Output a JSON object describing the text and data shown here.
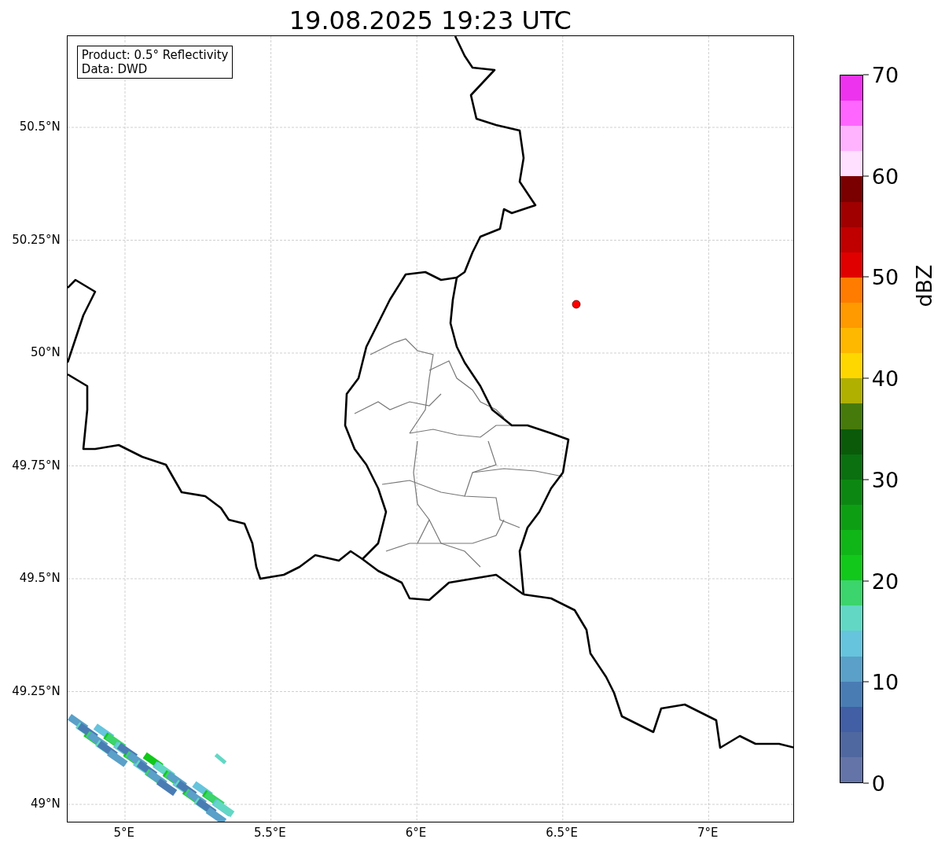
{
  "title": "19.08.2025 19:23 UTC",
  "info_box": {
    "lines": [
      "Product: 0.5° Reflectivity",
      "Data: DWD"
    ]
  },
  "map": {
    "yticks": [
      "50.5°N",
      "50.25°N",
      "50°N",
      "49.75°N",
      "49.5°N",
      "49.25°N",
      "49°N"
    ],
    "xticks": [
      "5°E",
      "5.5°E",
      "6°E",
      "6.5°E",
      "7°E"
    ]
  },
  "colorbar": {
    "label": "dBZ",
    "ticks": [
      "70",
      "60",
      "50",
      "40",
      "30",
      "20",
      "10",
      "0"
    ],
    "segments": [
      {
        "color": "#ee33ee"
      },
      {
        "color": "#ff66ff"
      },
      {
        "color": "#ffb3ff"
      },
      {
        "color": "#ffe0ff"
      },
      {
        "color": "#7a0000"
      },
      {
        "color": "#a00000"
      },
      {
        "color": "#c00000"
      },
      {
        "color": "#e00000"
      },
      {
        "color": "#ff7c00"
      },
      {
        "color": "#ff9a00"
      },
      {
        "color": "#ffb800"
      },
      {
        "color": "#ffd700"
      },
      {
        "color": "#b0b000"
      },
      {
        "color": "#467a0a"
      },
      {
        "color": "#0a5a0a"
      },
      {
        "color": "#0a7010"
      },
      {
        "color": "#0c8812"
      },
      {
        "color": "#0e9e14"
      },
      {
        "color": "#10b618"
      },
      {
        "color": "#12c81a"
      },
      {
        "color": "#3cd46c"
      },
      {
        "color": "#62d8c4"
      },
      {
        "color": "#66c4dc"
      },
      {
        "color": "#5aa0c8"
      },
      {
        "color": "#4a7cb4"
      },
      {
        "color": "#425ea4"
      },
      {
        "color": "#5068a0"
      },
      {
        "color": "#6474a8"
      }
    ]
  }
}
